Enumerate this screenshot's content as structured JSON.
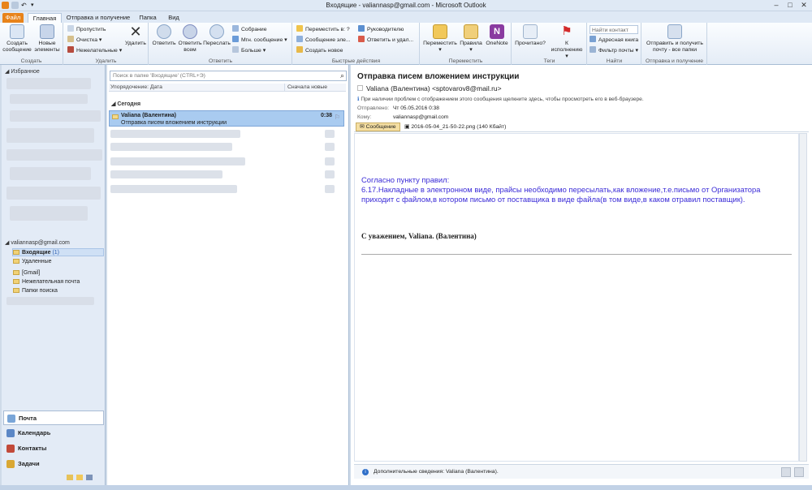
{
  "window": {
    "title": "Входящие - valiannasp@gmail.com - Microsoft Outlook"
  },
  "tabs": [
    "Файл",
    "Главная",
    "Отправка и получение",
    "Папка",
    "Вид"
  ],
  "ribbon": {
    "create": {
      "new_email": "Создать сообщение",
      "new_items": "Новые элементы",
      "label": "Создать"
    },
    "delete": {
      "ignore": "Пропустить",
      "clean": "Очистка",
      "junk": "Нежелательные",
      "delete": "Удалить",
      "label": "Удалить"
    },
    "respond": {
      "reply": "Ответить",
      "reply_all": "Ответить всем",
      "forward": "Переслать",
      "meeting": "Собрание",
      "im": "Мгн. сообщение",
      "more": "Больше",
      "label": "Ответить"
    },
    "quick_steps": {
      "move_to": "Переместить в: ?",
      "to_manager": "Руководителю",
      "team_email": "Сообщение эле...",
      "reply_delete": "Ответить и удал...",
      "create_new": "Создать новое",
      "label": "Быстрые действия"
    },
    "move": {
      "move": "Переместить",
      "rules": "Правила",
      "onenote": "OneNote",
      "label": "Переместить"
    },
    "tags": {
      "read": "Прочитано?",
      "followup": "К исполнению",
      "label": "Теги"
    },
    "find": {
      "find_contact": "Найти контакт",
      "address_book": "Адресная книга",
      "filter_email": "Фильтр почты",
      "label": "Найти"
    },
    "send_receive": {
      "send_all": "Отправить и получить почту - все папки",
      "label": "Отправка и получение"
    }
  },
  "nav": {
    "favorites": "Избранное",
    "account": "valiannasp@gmail.com",
    "folders": [
      {
        "name": "Входящие",
        "count": "(1)"
      },
      {
        "name": "Удаленные",
        "count": ""
      },
      {
        "name": "[Gmail]",
        "count": ""
      },
      {
        "name": "Нежелательная почта",
        "count": ""
      },
      {
        "name": "Папки поиска",
        "count": ""
      }
    ],
    "bottom": [
      "Почта",
      "Календарь",
      "Контакты",
      "Задачи"
    ]
  },
  "list": {
    "search_placeholder": "Поиск в папке 'Входящие' (CTRL+Э)",
    "sort_label": "Упорядочение: Дата",
    "order_label": "Сначала новые",
    "group": "Сегодня",
    "selected": {
      "from": "Valiana (Валентина)",
      "subject": "Отправка писем вложением инструкции",
      "time": "0:38"
    }
  },
  "message": {
    "subject": "Отправка писем вложением инструкции",
    "from": "Valiana (Валентина) <sptovarov8@mail.ru>",
    "info": "При наличии проблем с отображением этого сообщения щелкните здесь, чтобы просмотреть его в веб-браузере.",
    "sent_label": "Отправлено:",
    "sent_value": "Чт 05.05.2016 0:38",
    "to_label": "Кому:",
    "to_value": "valiannasp@gmail.com",
    "tab_message": "Сообщение",
    "attachment": "2016-05-04_21-50-22.png (140 Кбайт)",
    "body_lines": [
      "Согласно пункту правил:",
      "6.17.Накладные в электронном виде, прайсы необходимо пересылать,как вложение,т.е.письмо от Организатора",
      "приходит с файлом,в котором письмо от поставщика в виде файла(в том виде,в каком отравил поставщик)."
    ],
    "signature": "С уважением, Valiana. (Валентина)",
    "people_info": "Дополнительные сведения: Valiana (Валентина)."
  }
}
